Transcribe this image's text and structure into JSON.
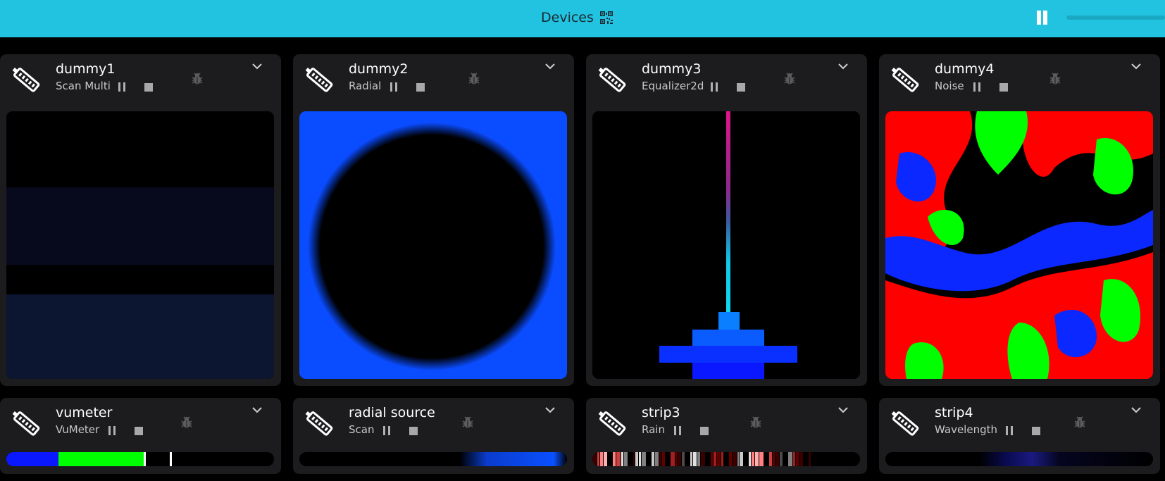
{
  "header": {
    "title": "Devices",
    "qr_icon": "qr-code-icon",
    "pause_icon": "pause-icon"
  },
  "devices": [
    {
      "name": "dummy1",
      "effect": "Scan Multi"
    },
    {
      "name": "dummy2",
      "effect": "Radial"
    },
    {
      "name": "dummy3",
      "effect": "Equalizer2d"
    },
    {
      "name": "dummy4",
      "effect": "Noise"
    },
    {
      "name": "vumeter",
      "effect": "VuMeter"
    },
    {
      "name": "radial source",
      "effect": "Scan"
    },
    {
      "name": "strip3",
      "effect": "Rain"
    },
    {
      "name": "strip4",
      "effect": "Wavelength"
    }
  ],
  "icons": {
    "device": "led-strip-icon",
    "pause": "pause-icon",
    "stop": "stop-icon",
    "debug": "bug-icon",
    "expand": "chevron-down-icon"
  },
  "colors": {
    "accent": "#22c3e0",
    "card": "#1c1c1e",
    "blue": "#0a46ff",
    "green": "#00ff00",
    "red": "#ff0000"
  }
}
